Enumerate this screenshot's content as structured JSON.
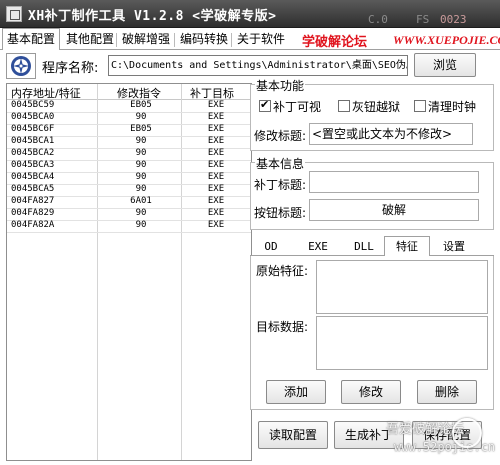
{
  "title": {
    "text": "XH补丁制作工具 V1.2.8 <学破解专版>",
    "deco_text": [
      "C.0",
      "FS",
      "0023"
    ]
  },
  "menu": {
    "tabs": [
      "基本配置",
      "其他配置",
      "破解增强",
      "编码转换",
      "关于软件"
    ],
    "active_tab": "基本配置",
    "forum_label": "学破解论坛",
    "forum_url": "WWW.XUEPOJIE.COM"
  },
  "program": {
    "label": "程序名称:",
    "path": "C:\\Documents and Settings\\Administrator\\桌面\\SEO伪原创",
    "browse_label": "浏览"
  },
  "patch_list": {
    "headers": [
      "内存地址/特征",
      "修改指令",
      "补丁目标"
    ],
    "rows": [
      [
        "0045BC59",
        "EB05",
        "EXE"
      ],
      [
        "0045BCA0",
        "90",
        "EXE"
      ],
      [
        "0045BC6F",
        "EB05",
        "EXE"
      ],
      [
        "0045BCA1",
        "90",
        "EXE"
      ],
      [
        "0045BCA2",
        "90",
        "EXE"
      ],
      [
        "0045BCA3",
        "90",
        "EXE"
      ],
      [
        "0045BCA4",
        "90",
        "EXE"
      ],
      [
        "0045BCA5",
        "90",
        "EXE"
      ],
      [
        "004FA827",
        "6A01",
        "EXE"
      ],
      [
        "004FA829",
        "90",
        "EXE"
      ],
      [
        "004FA82A",
        "90",
        "EXE"
      ]
    ]
  },
  "basic_function": {
    "title": "基本功能",
    "checkboxes": [
      {
        "label": "补丁可视",
        "checked": true
      },
      {
        "label": "灰钮越狱",
        "checked": false
      },
      {
        "label": "清理时钟",
        "checked": false
      }
    ],
    "modify_title_label": "修改标题:",
    "modify_title_value": "<置空或此文本为不修改>"
  },
  "basic_info": {
    "title": "基本信息",
    "patch_title_label": "补丁标题:",
    "patch_title_value": "",
    "button_title_label": "按钮标题:",
    "button_title_value": "破解"
  },
  "sub_tabs": {
    "items": [
      "OD",
      "EXE",
      "DLL",
      "特征",
      "设置"
    ],
    "active": "特征"
  },
  "feature_panel": {
    "original_label": "原始特征:",
    "target_label": "目标数据:",
    "add_label": "添加",
    "modify_label": "修改",
    "delete_label": "删除"
  },
  "bottom": {
    "read_label": "读取配置",
    "generate_label": "生成补丁",
    "save_label": "保存配置"
  },
  "watermark": {
    "line1": "吾爱破解论坛",
    "line2": "www.52pojie.cn"
  }
}
